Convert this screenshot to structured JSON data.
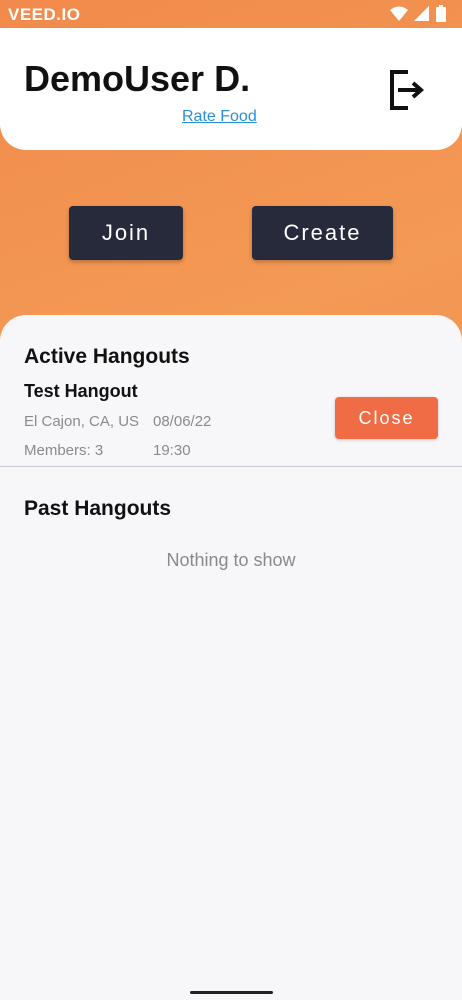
{
  "status_bar": {
    "watermark": "VEED.IO",
    "icons": [
      "wifi-icon",
      "cellular-signal-icon",
      "battery-icon"
    ]
  },
  "header": {
    "user_name": "DemoUser D.",
    "rate_food_link": "Rate Food",
    "logout_icon": "logout-icon"
  },
  "actions": {
    "join_label": "Join",
    "create_label": "Create"
  },
  "active_hangouts": {
    "title": "Active Hangouts",
    "items": [
      {
        "name": "Test Hangout",
        "location": "El Cajon, CA, US",
        "date": "08/06/22",
        "members": "Members: 3",
        "time": "19:30",
        "close_label": "Close"
      }
    ]
  },
  "past_hangouts": {
    "title": "Past Hangouts",
    "empty_text": "Nothing to show"
  },
  "colors": {
    "background_orange": "#f28a4b",
    "dark_button": "#262a3b",
    "close_button": "#ef6c45",
    "link": "#2a8fd6"
  }
}
